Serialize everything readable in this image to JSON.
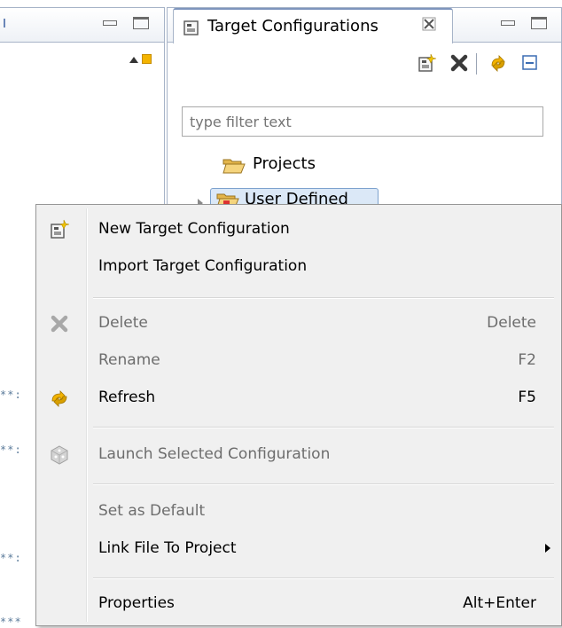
{
  "view": {
    "tab_title": "Target Configurations",
    "tab_icon": "target-config-icon",
    "close_icon": "close-icon",
    "filter": {
      "placeholder": "type filter text",
      "value": ""
    },
    "toolbar": [
      {
        "name": "new-target-config-icon"
      },
      {
        "name": "delete-icon"
      },
      {
        "name": "refresh-icon"
      },
      {
        "name": "collapse-all-icon"
      }
    ],
    "tree": [
      {
        "label": "Projects",
        "icon": "folder-open-icon"
      },
      {
        "label": "User Defined",
        "icon": "folder-user-icon"
      }
    ]
  },
  "left_pane": {
    "stars": [
      "**:",
      "**:",
      "**:",
      "***"
    ]
  },
  "context_menu": {
    "items": [
      {
        "label": "New Target Configuration",
        "shortcut": "",
        "icon": "new-target-config-icon",
        "enabled": true
      },
      {
        "label": "Import Target Configuration",
        "shortcut": "",
        "icon": "",
        "enabled": true
      },
      {
        "label": "Delete",
        "shortcut": "Delete",
        "icon": "delete-icon",
        "enabled": false
      },
      {
        "label": "Rename",
        "shortcut": "F2",
        "icon": "",
        "enabled": false
      },
      {
        "label": "Refresh",
        "shortcut": "F5",
        "icon": "refresh-icon",
        "enabled": true
      },
      {
        "label": "Launch Selected Configuration",
        "shortcut": "",
        "icon": "launch-icon",
        "enabled": false
      },
      {
        "label": "Set as Default",
        "shortcut": "",
        "icon": "",
        "enabled": false
      },
      {
        "label": "Link File To Project",
        "shortcut": "",
        "icon": "",
        "enabled": true,
        "submenu": true
      },
      {
        "label": "Properties",
        "shortcut": "Alt+Enter",
        "icon": "",
        "enabled": true
      }
    ]
  },
  "colors": {
    "menu_bg": "#f0f0f0",
    "selection": "#dbe8f7",
    "disabled_text": "#6d6d6d"
  }
}
